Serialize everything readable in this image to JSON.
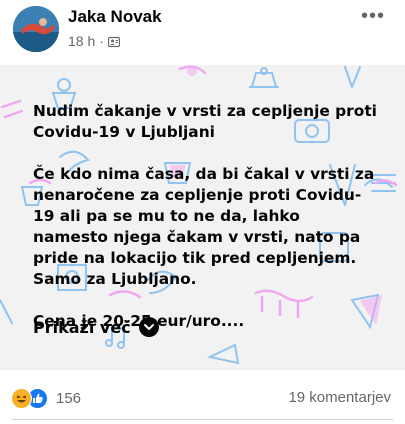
{
  "post": {
    "author": "Jaka Novak",
    "time": "18 h",
    "time_separator": "·",
    "privacy_icon": "friends-icon",
    "more_label": "•••",
    "paragraphs": [
      "Nudim čakanje v vrsti za cepljenje proti Covidu-19 v Ljubljani",
      "Če kdo nima časa, da bi čakal v vrsti za nenaročene za cepljenje proti Covidu-19 ali pa se mu to ne da, lahko namesto njega čakam v vrsti, nato pa pride na lokacijo tik pred cepljenjem. Samo za Ljubljano.",
      "Cena je 20-25 eur/uro...."
    ],
    "see_more_label": "Prikaži več",
    "reaction_count": "156",
    "comments_label": "19 komentarjev"
  },
  "colors": {
    "card_background": "#f2f2f2",
    "doodle_blue": "#8fc3f0",
    "doodle_pink": "#f0a8f0",
    "text_secondary": "#65676b",
    "like_blue": "#1877f2",
    "haha_yellow": "#f7b125"
  },
  "icons": [
    "avatar",
    "friends-icon",
    "more-icon",
    "chevron-down-icon",
    "haha-reaction-icon",
    "like-reaction-icon"
  ]
}
